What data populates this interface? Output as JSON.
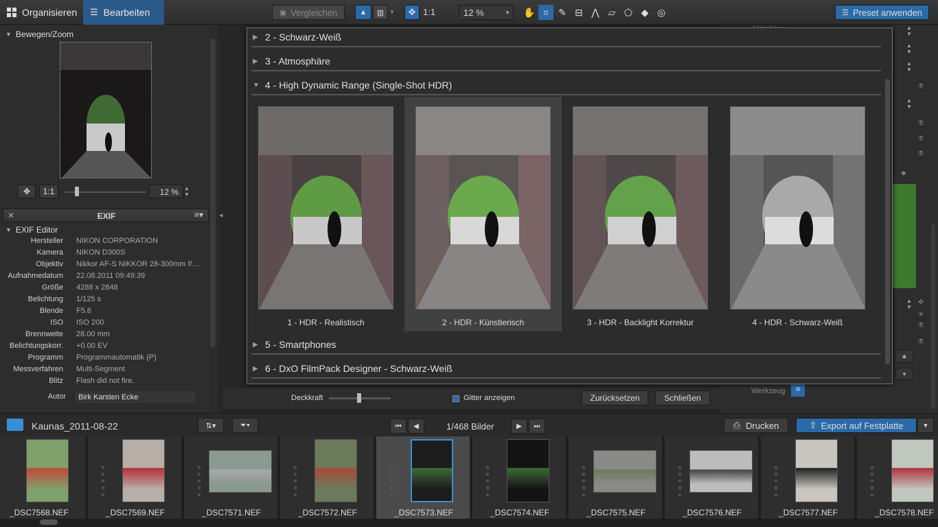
{
  "toolbar": {
    "tab_organize": "Organisieren",
    "tab_edit": "Bearbeiten",
    "compare": "Vergleichen",
    "zoom_fit": "1:1",
    "zoom_value": "12 %",
    "apply_preset": "Preset anwenden"
  },
  "navigator": {
    "title": "Bewegen/Zoom",
    "zoom_fit": "1:1",
    "zoom_value": "12 %"
  },
  "exif": {
    "panel_title": "EXIF",
    "editor_title": "EXIF Editor",
    "rows": [
      {
        "key": "Hersteller",
        "value": "NIKON CORPORATION"
      },
      {
        "key": "Kamera",
        "value": "NIKON D300S"
      },
      {
        "key": "Objektiv",
        "value": "Nikkor AF-S NIKKOR 28-300mm f/…"
      },
      {
        "key": "Aufnahmedatum",
        "value": "22.08.2011 09:49:39"
      },
      {
        "key": "Größe",
        "value": "4288 x 2848"
      },
      {
        "key": "Belichtung",
        "value": "1/125 s"
      },
      {
        "key": "Blende",
        "value": "F5.6"
      },
      {
        "key": "ISO",
        "value": "ISO 200"
      },
      {
        "key": "Brennweite",
        "value": "28.00 mm"
      },
      {
        "key": "Belichtungskorr.",
        "value": "+0.00 EV"
      },
      {
        "key": "Programm",
        "value": "Programmautomatik (P)"
      },
      {
        "key": "Messverfahren",
        "value": "Multi-Segment"
      },
      {
        "key": "Blitz",
        "value": "Flash did not fire."
      }
    ],
    "author_label": "Autor",
    "author_value": "Birk Karsten Ecke"
  },
  "presets": {
    "groups": [
      {
        "label": "2 - Schwarz-Weiß",
        "expanded": false
      },
      {
        "label": "3 - Atmosphäre",
        "expanded": false
      },
      {
        "label": "4 - High Dynamic Range (Single-Shot HDR)",
        "expanded": true
      },
      {
        "label": "5 - Smartphones",
        "expanded": false
      },
      {
        "label": "6 - DxO FilmPack Designer - Schwarz-Weiß",
        "expanded": false
      }
    ],
    "items": [
      {
        "label": "1 - HDR - Realistisch",
        "selected": false
      },
      {
        "label": "2 - HDR - Künstlerisch",
        "selected": true
      },
      {
        "label": "3 - HDR - Backlight Korrektur",
        "selected": false
      },
      {
        "label": "4 - HDR - Schwarz-Weiß",
        "selected": false
      }
    ]
  },
  "bottom_controls": {
    "opacity_label": "Deckkraft",
    "grid_label": "Gitter anzeigen",
    "reset": "Zurücksetzen",
    "close": "Schließen"
  },
  "right_panel": {
    "partial_label": "Mitteltöne",
    "tool_label": "Werkzeug"
  },
  "filmstrip": {
    "folder": "Kaunas_2011-08-22",
    "counter": "1/468 Bilder",
    "print": "Drucken",
    "export": "Export auf Festplatte",
    "files": [
      {
        "name": "_DSC7568.NEF",
        "orientation": "portrait",
        "selected": false
      },
      {
        "name": "_DSC7569.NEF",
        "orientation": "portrait",
        "selected": false
      },
      {
        "name": "_DSC7571.NEF",
        "orientation": "landscape",
        "selected": false
      },
      {
        "name": "_DSC7572.NEF",
        "orientation": "portrait",
        "selected": false
      },
      {
        "name": "_DSC7573.NEF",
        "orientation": "portrait",
        "selected": true
      },
      {
        "name": "_DSC7574.NEF",
        "orientation": "portrait",
        "selected": false
      },
      {
        "name": "_DSC7575.NEF",
        "orientation": "landscape",
        "selected": false
      },
      {
        "name": "_DSC7576.NEF",
        "orientation": "landscape",
        "selected": false
      },
      {
        "name": "_DSC7577.NEF",
        "orientation": "portrait",
        "selected": false
      },
      {
        "name": "_DSC7578.NEF",
        "orientation": "portrait",
        "selected": false
      }
    ]
  },
  "colors": {
    "accent": "#2b6aa8",
    "panel": "#2d2d2d",
    "strip": "#1f1f1f"
  }
}
